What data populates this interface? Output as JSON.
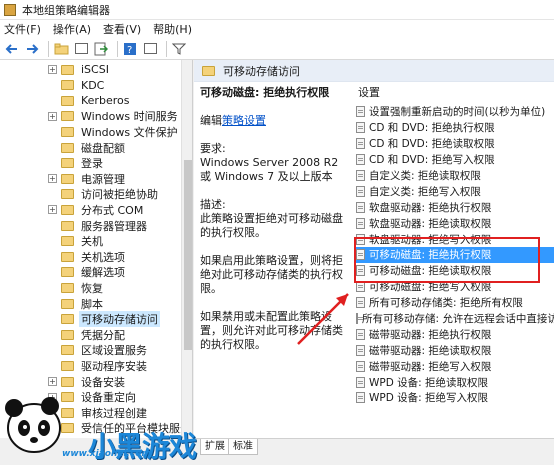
{
  "window": {
    "title": "本地组策略编辑器"
  },
  "menu": [
    "文件(F)",
    "操作(A)",
    "查看(V)",
    "帮助(H)"
  ],
  "tree": {
    "items": [
      {
        "label": "iSCSI",
        "expander": "+"
      },
      {
        "label": "KDC",
        "expander": ""
      },
      {
        "label": "Kerberos",
        "expander": ""
      },
      {
        "label": "Windows 时间服务",
        "expander": "+"
      },
      {
        "label": "Windows 文件保护",
        "expander": ""
      },
      {
        "label": "磁盘配额",
        "expander": ""
      },
      {
        "label": "登录",
        "expander": ""
      },
      {
        "label": "电源管理",
        "expander": "+"
      },
      {
        "label": "访问被拒绝协助",
        "expander": ""
      },
      {
        "label": "分布式 COM",
        "expander": "+"
      },
      {
        "label": "服务器管理器",
        "expander": ""
      },
      {
        "label": "关机",
        "expander": ""
      },
      {
        "label": "关机选项",
        "expander": ""
      },
      {
        "label": "缓解选项",
        "expander": ""
      },
      {
        "label": "恢复",
        "expander": ""
      },
      {
        "label": "脚本",
        "expander": ""
      },
      {
        "label": "可移动存储访问",
        "expander": "",
        "selected": true
      },
      {
        "label": "凭据分配",
        "expander": ""
      },
      {
        "label": "区域设置服务",
        "expander": ""
      },
      {
        "label": "驱动程序安装",
        "expander": ""
      },
      {
        "label": "设备安装",
        "expander": "+"
      },
      {
        "label": "设备重定向",
        "expander": "+"
      },
      {
        "label": "审核过程创建",
        "expander": ""
      },
      {
        "label": "受信任的平台模块服务",
        "expander": ""
      }
    ]
  },
  "right": {
    "header": "可移动存储访问",
    "policy_title": "可移动磁盘: 拒绝执行权限",
    "edit_prefix": "编辑",
    "edit_link": "策略设置",
    "requirement_label": "要求:",
    "requirement_text": "Windows Server 2008 R2 或 Windows 7 及以上版本",
    "description_label": "描述:",
    "description_text": "此策略设置拒绝对可移动磁盘的执行权限。",
    "enabled_text": "如果启用此策略设置，则将拒绝对此可移动存储类的执行权限。",
    "disabled_text": "如果禁用或未配置此策略设置，则允许对此可移动存储类的执行权限。",
    "settings_header": "设置",
    "settings": [
      {
        "label": "设置强制重新启动的时间(以秒为单位)"
      },
      {
        "label": "CD 和 DVD: 拒绝执行权限"
      },
      {
        "label": "CD 和 DVD: 拒绝读取权限"
      },
      {
        "label": "CD 和 DVD: 拒绝写入权限"
      },
      {
        "label": "自定义类: 拒绝读取权限"
      },
      {
        "label": "自定义类: 拒绝写入权限"
      },
      {
        "label": "软盘驱动器: 拒绝执行权限"
      },
      {
        "label": "软盘驱动器: 拒绝读取权限"
      },
      {
        "label": "软盘驱动器: 拒绝写入权限"
      },
      {
        "label": "可移动磁盘: 拒绝执行权限",
        "selected": true
      },
      {
        "label": "可移动磁盘: 拒绝读取权限"
      },
      {
        "label": "可移动磁盘: 拒绝写入权限"
      },
      {
        "label": "所有可移动存储类: 拒绝所有权限"
      },
      {
        "label": "所有可移动存储: 允许在远程会话中直接访问"
      },
      {
        "label": "磁带驱动器: 拒绝执行权限"
      },
      {
        "label": "磁带驱动器: 拒绝读取权限"
      },
      {
        "label": "磁带驱动器: 拒绝写入权限"
      },
      {
        "label": "WPD 设备: 拒绝读取权限"
      },
      {
        "label": "WPD 设备: 拒绝写入权限"
      }
    ]
  },
  "tabs": [
    "扩展",
    "标准"
  ],
  "watermark": {
    "brand": "小黑游戏",
    "url": "www.xiaohei.com"
  },
  "colors": {
    "selection": "#3399ff",
    "annotation": "#e02020",
    "link": "#0050c8"
  }
}
